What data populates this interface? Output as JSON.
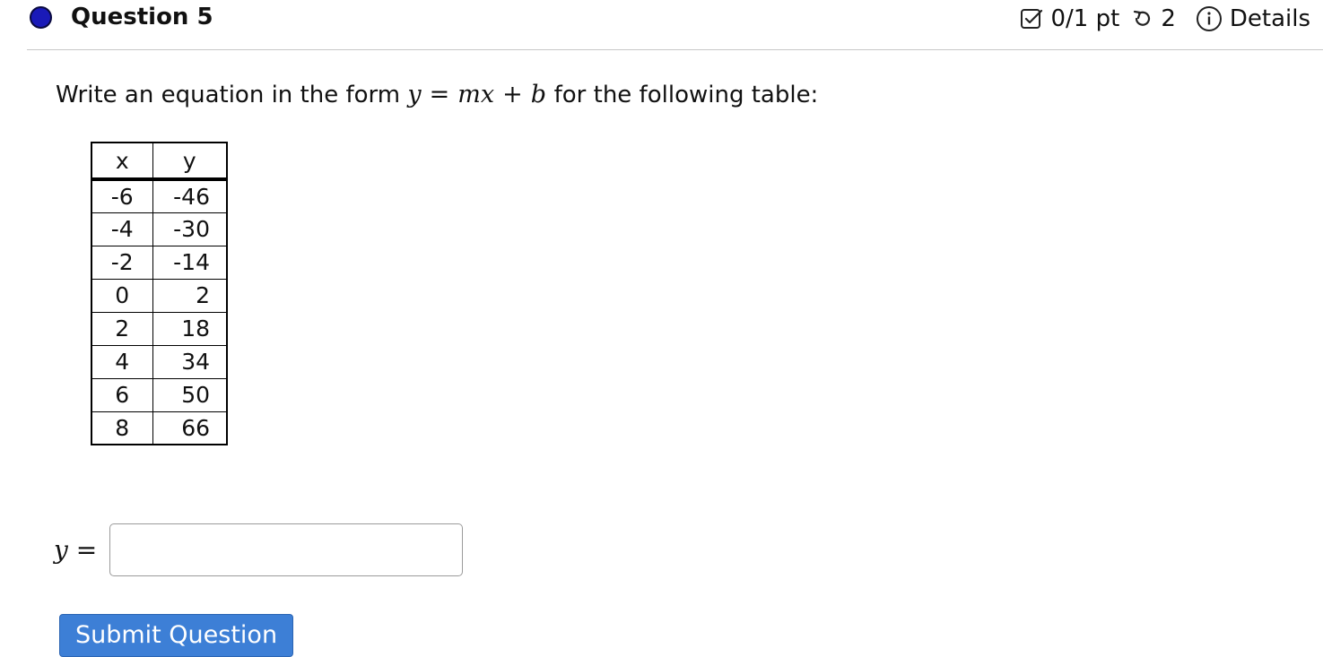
{
  "header": {
    "title": "Question 5",
    "score": "0/1 pt",
    "attempts": "2",
    "details_label": "Details",
    "dot_color": "#1a1ab8"
  },
  "question": {
    "prompt_before": "Write an equation in the form",
    "math_y": "y",
    "math_eq": "=",
    "math_mx": "mx",
    "math_plus": "+",
    "math_b": "b",
    "prompt_after": "for the following table:"
  },
  "table": {
    "headers": [
      "x",
      "y"
    ],
    "rows": [
      [
        "-6",
        "-46"
      ],
      [
        "-4",
        "-30"
      ],
      [
        "-2",
        "-14"
      ],
      [
        "0",
        "2"
      ],
      [
        "2",
        "18"
      ],
      [
        "4",
        "34"
      ],
      [
        "6",
        "50"
      ],
      [
        "8",
        "66"
      ]
    ]
  },
  "answer": {
    "label": "y =",
    "value": ""
  },
  "submit_label": "Submit Question",
  "colors": {
    "accent": "#3d7fd6"
  }
}
